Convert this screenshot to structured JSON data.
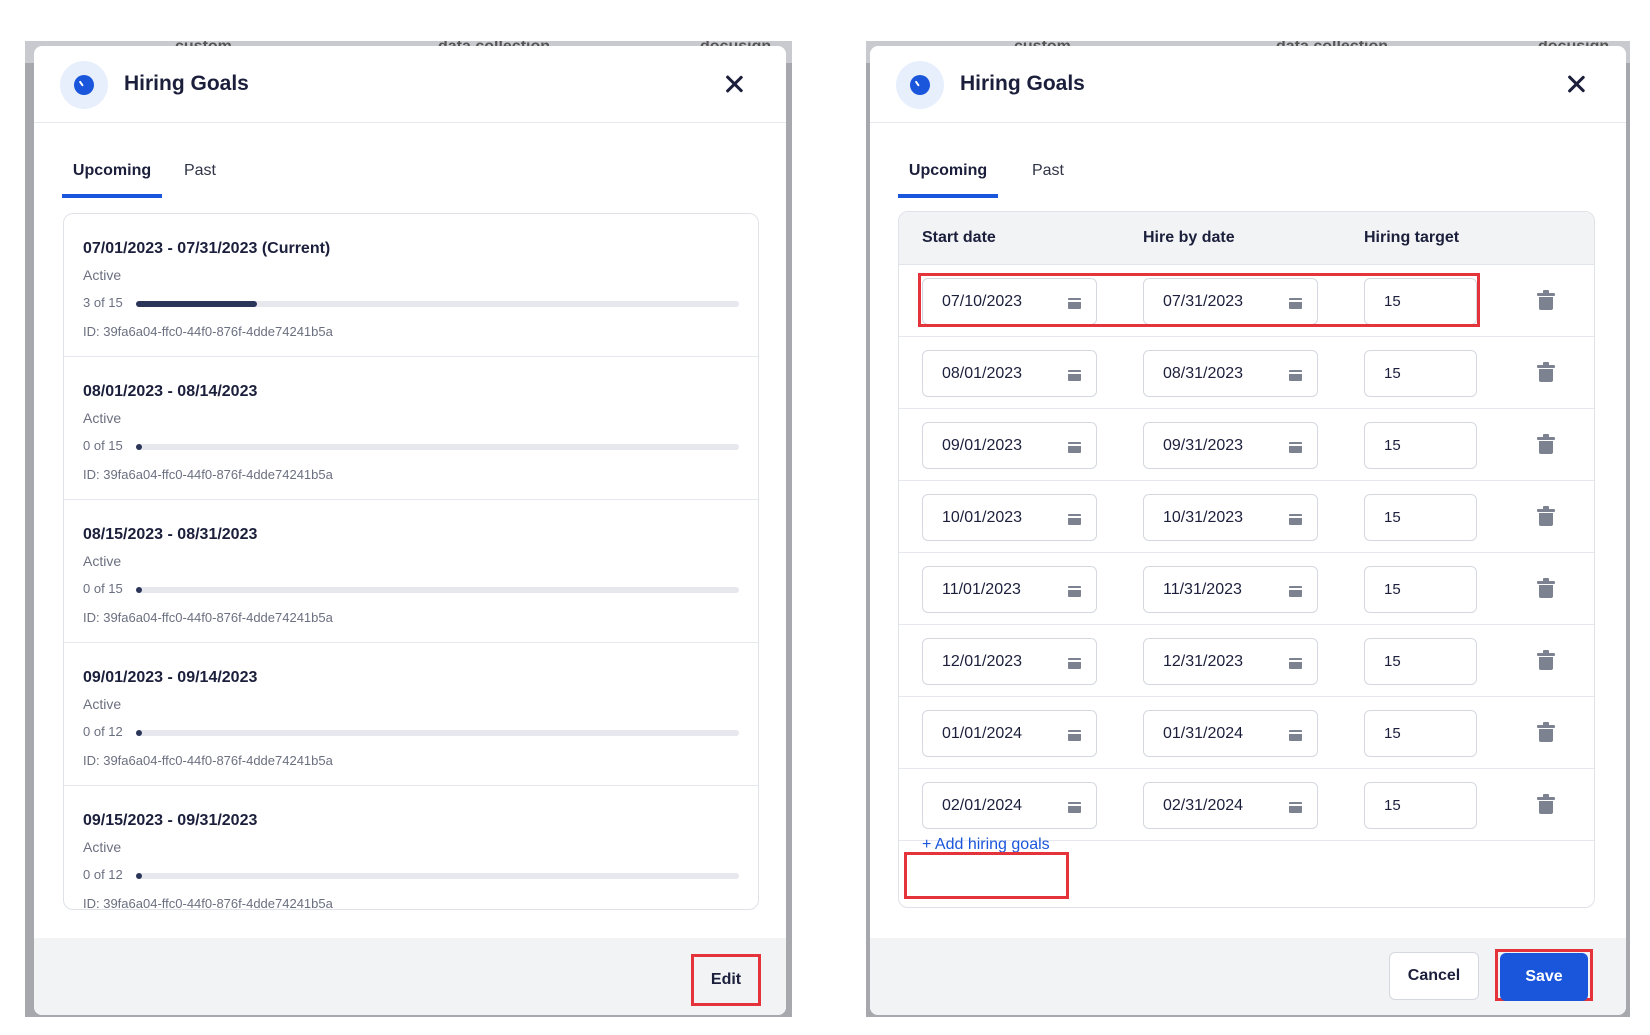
{
  "backdrop": {
    "tabs": [
      "custom",
      "data collection",
      "docusign"
    ]
  },
  "left_panel": {
    "title": "Hiring Goals",
    "tabs": [
      {
        "label": "Upcoming",
        "active": true
      },
      {
        "label": "Past",
        "active": false
      }
    ],
    "goals": [
      {
        "range": "07/01/2023 - 07/31/2023 (Current)",
        "status": "Active",
        "progress_label": "3 of 15",
        "progress": 0.2,
        "id": "ID: 39fa6a04-ffc0-44f0-876f-4dde74241b5a"
      },
      {
        "range": "08/01/2023 - 08/14/2023",
        "status": "Active",
        "progress_label": "0 of 15",
        "progress": 0,
        "id": "ID: 39fa6a04-ffc0-44f0-876f-4dde74241b5a"
      },
      {
        "range": "08/15/2023 - 08/31/2023",
        "status": "Active",
        "progress_label": "0 of 15",
        "progress": 0,
        "id": "ID: 39fa6a04-ffc0-44f0-876f-4dde74241b5a"
      },
      {
        "range": "09/01/2023 - 09/14/2023",
        "status": "Active",
        "progress_label": "0 of 12",
        "progress": 0,
        "id": "ID: 39fa6a04-ffc0-44f0-876f-4dde74241b5a"
      },
      {
        "range": "09/15/2023 - 09/31/2023",
        "status": "Active",
        "progress_label": "0 of 12",
        "progress": 0,
        "id": "ID: 39fa6a04-ffc0-44f0-876f-4dde74241b5a"
      }
    ],
    "edit_label": "Edit"
  },
  "right_panel": {
    "title": "Hiring Goals",
    "tabs": [
      {
        "label": "Upcoming",
        "active": true
      },
      {
        "label": "Past",
        "active": false
      }
    ],
    "columns": {
      "start": "Start date",
      "hire_by": "Hire by date",
      "target": "Hiring target"
    },
    "rows": [
      {
        "start": "07/10/2023",
        "hire_by": "07/31/2023",
        "target": "15"
      },
      {
        "start": "08/01/2023",
        "hire_by": "08/31/2023",
        "target": "15"
      },
      {
        "start": "09/01/2023",
        "hire_by": "09/31/2023",
        "target": "15"
      },
      {
        "start": "10/01/2023",
        "hire_by": "10/31/2023",
        "target": "15"
      },
      {
        "start": "11/01/2023",
        "hire_by": "11/31/2023",
        "target": "15"
      },
      {
        "start": "12/01/2023",
        "hire_by": "12/31/2023",
        "target": "15"
      },
      {
        "start": "01/01/2024",
        "hire_by": "01/31/2024",
        "target": "15"
      },
      {
        "start": "02/01/2024",
        "hire_by": "02/31/2024",
        "target": "15"
      }
    ],
    "add_label": "+ Add hiring goals",
    "cancel_label": "Cancel",
    "save_label": "Save"
  },
  "colors": {
    "accent": "#1a56db",
    "highlight": "#e5333c",
    "progress": "#2b3558"
  }
}
